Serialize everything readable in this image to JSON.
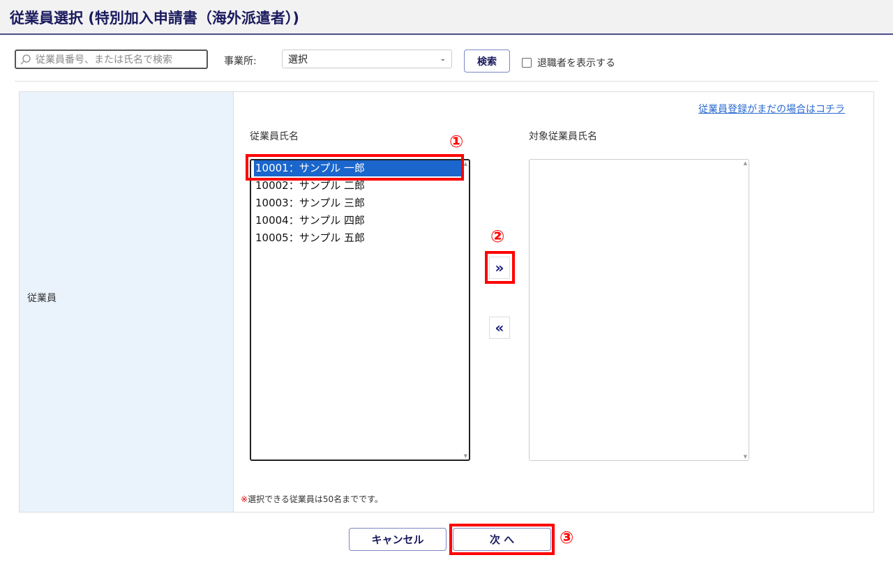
{
  "header": {
    "title": "従業員選択 (特別加入申請書（海外派遣者）)"
  },
  "filter": {
    "search_placeholder": "従業員番号、または氏名で検索",
    "office_label": "事業所:",
    "office_value": "選択",
    "search_button": "検索",
    "show_retired_label": "退職者を表示する",
    "show_retired_checked": false
  },
  "form": {
    "row_label": "従業員",
    "register_link": "従業員登録がまだの場合はコチラ",
    "available_label": "従業員氏名",
    "target_label": "対象従業員氏名",
    "employees": [
      "10001：サンプル 一郎",
      "10002：サンプル 二郎",
      "10003：サンプル 三郎",
      "10004：サンプル 四郎",
      "10005：サンプル 五郎"
    ],
    "selected_index": 0,
    "add_button": "»",
    "remove_button": "«",
    "note_mark": "※",
    "note": "選択できる従業員は50名までです。"
  },
  "footer": {
    "cancel": "キャンセル",
    "next": "次 へ"
  },
  "annotations": [
    "①",
    "②",
    "③"
  ]
}
